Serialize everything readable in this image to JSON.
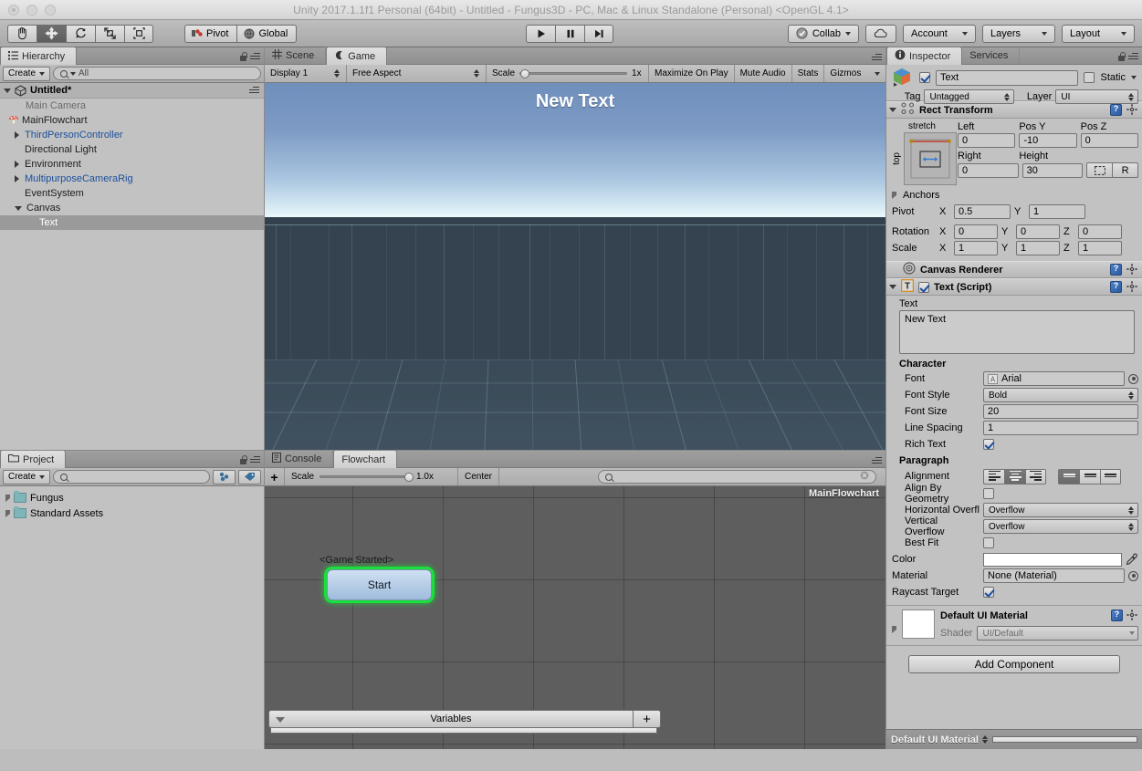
{
  "window": {
    "title": "Unity 2017.1.1f1 Personal (64bit) - Untitled - Fungus3D - PC, Mac & Linux Standalone (Personal) <OpenGL 4.1>"
  },
  "toolbar": {
    "tools": [
      "hand-tool",
      "move-tool",
      "rotate-tool",
      "scale-tool",
      "rect-tool"
    ],
    "pivot_label": "Pivot",
    "global_label": "Global",
    "play_label": "play-button",
    "pause_label": "pause-button",
    "step_label": "step-button",
    "collab_label": "Collab",
    "cloud_label": "cloud-button",
    "account_label": "Account",
    "layers_label": "Layers",
    "layout_label": "Layout"
  },
  "hierarchy": {
    "tab_label": "Hierarchy",
    "create_label": "Create",
    "search_placeholder": "All",
    "scene_name": "Untitled*",
    "items": [
      {
        "label": "Main Camera",
        "depth": 1,
        "arrow": "none",
        "style": "dim",
        "icon": "none"
      },
      {
        "label": "MainFlowchart",
        "depth": 1,
        "arrow": "none",
        "style": "normal",
        "icon": "fungus-mushroom-icon"
      },
      {
        "label": "ThirdPersonController",
        "depth": 1,
        "arrow": "right",
        "style": "prefab",
        "icon": "none"
      },
      {
        "label": "Directional Light",
        "depth": 1,
        "arrow": "none",
        "style": "normal",
        "icon": "none"
      },
      {
        "label": "Environment",
        "depth": 1,
        "arrow": "right",
        "style": "normal",
        "icon": "none"
      },
      {
        "label": "MultipurposeCameraRig",
        "depth": 1,
        "arrow": "right",
        "style": "prefab",
        "icon": "none"
      },
      {
        "label": "EventSystem",
        "depth": 1,
        "arrow": "none",
        "style": "normal",
        "icon": "none"
      },
      {
        "label": "Canvas",
        "depth": 1,
        "arrow": "down",
        "style": "normal",
        "icon": "none"
      },
      {
        "label": "Text",
        "depth": 2,
        "arrow": "none",
        "style": "selected",
        "icon": "none"
      }
    ]
  },
  "project": {
    "tab_label": "Project",
    "create_label": "Create",
    "search_placeholder": "",
    "items": [
      {
        "label": "Fungus"
      },
      {
        "label": "Standard Assets"
      }
    ]
  },
  "gameview": {
    "tabs": [
      {
        "label": "Scene",
        "active": false,
        "icon": "grid-icon"
      },
      {
        "label": "Game",
        "active": true,
        "icon": "gamepad-icon"
      }
    ],
    "display_label": "Display 1",
    "aspect_label": "Free Aspect",
    "scale_label": "Scale",
    "scale_value": "1x",
    "maximize_label": "Maximize On Play",
    "mute_label": "Mute Audio",
    "stats_label": "Stats",
    "gizmos_label": "Gizmos",
    "overlay_text": "New Text"
  },
  "flowchart": {
    "tabs": [
      {
        "label": "Console",
        "active": false,
        "icon": "console-icon"
      },
      {
        "label": "Flowchart",
        "active": true,
        "icon": "none"
      }
    ],
    "add_label": "+",
    "scale_label": "Scale",
    "scale_value": "1.0x",
    "center_label": "Center",
    "search_placeholder": "",
    "chart_name": "MainFlowchart",
    "block_event_label": "<Game Started>",
    "block_name": "Start",
    "variables_label": "Variables",
    "variables_add_label": "+"
  },
  "inspector": {
    "tabs": [
      {
        "label": "Inspector",
        "active": true
      },
      {
        "label": "Services",
        "active": false
      }
    ],
    "object_name": "Text",
    "object_enabled": true,
    "static_label": "Static",
    "tag_label": "Tag",
    "tag_value": "Untagged",
    "layer_label": "Layer",
    "layer_value": "UI",
    "rect_transform": {
      "title": "Rect Transform",
      "anchor_preset_top": "stretch",
      "anchor_preset_left": "top",
      "left_label": "Left",
      "left_value": "0",
      "posy_label": "Pos Y",
      "posy_value": "-10",
      "posz_label": "Pos Z",
      "posz_value": "0",
      "right_label": "Right",
      "right_value": "0",
      "height_label": "Height",
      "height_value": "30",
      "blueprint_label": "blueprint-mode-button",
      "raw_label": "R",
      "anchors_label": "Anchors",
      "pivot_label": "Pivot",
      "pivot_x": "0.5",
      "pivot_y": "1",
      "rotation_label": "Rotation",
      "rotation_x": "0",
      "rotation_y": "0",
      "rotation_z": "0",
      "scale_label": "Scale",
      "scale_x": "1",
      "scale_y": "1",
      "scale_z": "1"
    },
    "canvas_renderer": {
      "title": "Canvas Renderer"
    },
    "text_script": {
      "title": "Text (Script)",
      "enabled": true,
      "text_label": "Text",
      "text_value": "New Text",
      "character_label": "Character",
      "font_label": "Font",
      "font_value": "Arial",
      "font_style_label": "Font Style",
      "font_style_value": "Bold",
      "font_size_label": "Font Size",
      "font_size_value": "20",
      "line_spacing_label": "Line Spacing",
      "line_spacing_value": "1",
      "rich_text_label": "Rich Text",
      "rich_text_checked": true,
      "paragraph_label": "Paragraph",
      "alignment_label": "Alignment",
      "alignment_h_selected": 1,
      "alignment_v_selected": 0,
      "align_geometry_label": "Align By Geometry",
      "align_geometry_checked": false,
      "h_overflow_label": "Horizontal Overflow",
      "h_overflow_value": "Overflow",
      "v_overflow_label": "Vertical Overflow",
      "v_overflow_value": "Overflow",
      "best_fit_label": "Best Fit",
      "best_fit_checked": false,
      "color_label": "Color",
      "color_value": "#ffffff",
      "material_label": "Material",
      "material_value": "None (Material)",
      "raycast_label": "Raycast Target",
      "raycast_checked": true
    },
    "material_block": {
      "title": "Default UI Material",
      "shader_label": "Shader",
      "shader_value": "UI/Default"
    },
    "add_component_label": "Add Component",
    "footer_label": "Default UI Material"
  }
}
